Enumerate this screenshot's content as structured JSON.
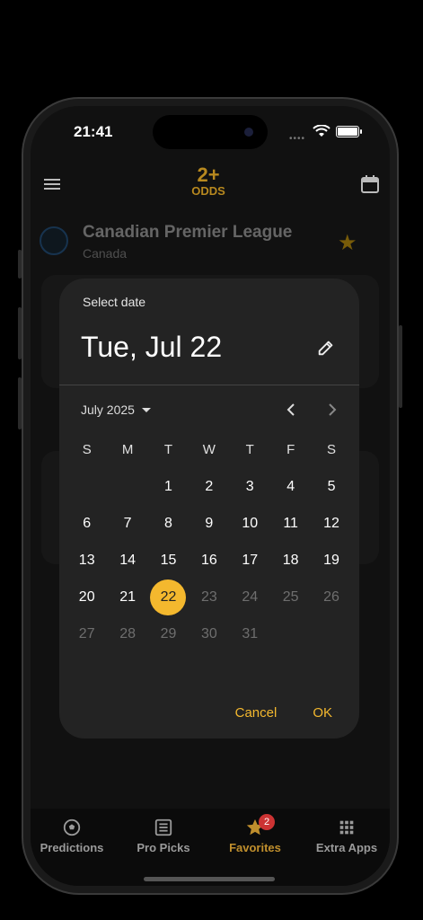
{
  "status_bar": {
    "time": "21:41"
  },
  "app_bar": {
    "logo_top": "2+",
    "logo_bottom": "ODDS"
  },
  "league": {
    "name": "Canadian Premier League",
    "country": "Canada"
  },
  "date_picker": {
    "header": "Select date",
    "selected_date": "Tue, Jul 22",
    "month_label": "July 2025",
    "weekdays": [
      "S",
      "M",
      "T",
      "W",
      "T",
      "F",
      "S"
    ],
    "weeks": [
      [
        "",
        "",
        "1",
        "2",
        "3",
        "4",
        "5"
      ],
      [
        "6",
        "7",
        "8",
        "9",
        "10",
        "11",
        "12"
      ],
      [
        "13",
        "14",
        "15",
        "16",
        "17",
        "18",
        "19"
      ],
      [
        "20",
        "21",
        "22",
        "23",
        "24",
        "25",
        "26"
      ],
      [
        "27",
        "28",
        "29",
        "30",
        "31",
        "",
        ""
      ]
    ],
    "selected_day": "22",
    "cancel_label": "Cancel",
    "ok_label": "OK",
    "accent_color": "#f4b82e"
  },
  "bottom_nav": {
    "items": [
      {
        "label": "Predictions",
        "icon": "soccer-ball-icon"
      },
      {
        "label": "Pro Picks",
        "icon": "list-box-icon"
      },
      {
        "label": "Favorites",
        "icon": "star-icon",
        "badge": "2",
        "active": true
      },
      {
        "label": "Extra Apps",
        "icon": "grid-apps-icon"
      }
    ]
  }
}
